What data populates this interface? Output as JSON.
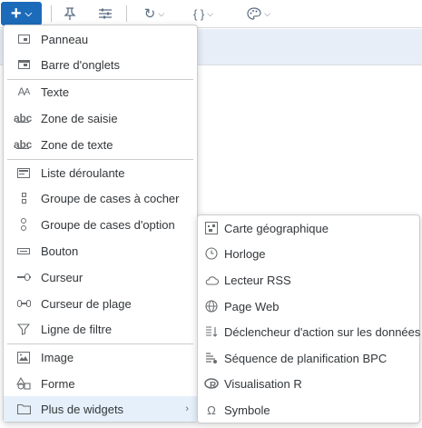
{
  "toolbar": {
    "add_icon": "plus-icon",
    "buttons": [
      {
        "name": "add-widget-button",
        "icon": "plus"
      },
      {
        "name": "pin-button",
        "icon": "pin"
      },
      {
        "name": "filter-button",
        "icon": "sliders"
      },
      {
        "name": "refresh-button",
        "icon": "refresh"
      },
      {
        "name": "script-button",
        "icon": "braces"
      },
      {
        "name": "theme-button",
        "icon": "palette"
      }
    ]
  },
  "menu": {
    "items": [
      {
        "label": "Panneau",
        "icon": "panel-icon"
      },
      {
        "label": "Barre d'onglets",
        "icon": "tabstrip-icon"
      },
      {
        "label": "Texte",
        "icon": "text-icon"
      },
      {
        "label": "Zone de saisie",
        "icon": "input-field-icon"
      },
      {
        "label": "Zone de texte",
        "icon": "text-area-icon"
      },
      {
        "label": "Liste déroulante",
        "icon": "dropdown-icon"
      },
      {
        "label": "Groupe de cases à cocher",
        "icon": "checkbox-group-icon"
      },
      {
        "label": "Groupe de cases d'option",
        "icon": "radio-group-icon"
      },
      {
        "label": "Bouton",
        "icon": "button-icon"
      },
      {
        "label": "Curseur",
        "icon": "slider-icon"
      },
      {
        "label": "Curseur de plage",
        "icon": "range-slider-icon"
      },
      {
        "label": "Ligne de filtre",
        "icon": "filter-icon"
      },
      {
        "label": "Image",
        "icon": "image-icon"
      },
      {
        "label": "Forme",
        "icon": "shape-icon"
      },
      {
        "label": "Plus de widgets",
        "icon": "folder-icon"
      }
    ]
  },
  "submenu": {
    "items": [
      {
        "label": "Carte géographique",
        "icon": "geo-map-icon"
      },
      {
        "label": "Horloge",
        "icon": "clock-icon"
      },
      {
        "label": "Lecteur RSS",
        "icon": "cloud-icon"
      },
      {
        "label": "Page Web",
        "icon": "globe-icon"
      },
      {
        "label": "Déclencheur d'action sur les données",
        "icon": "data-action-icon"
      },
      {
        "label": "Séquence de planification BPC",
        "icon": "bpc-sequence-icon"
      },
      {
        "label": "Visualisation R",
        "icon": "r-visualization-icon"
      },
      {
        "label": "Symbole",
        "icon": "symbol-icon"
      }
    ]
  },
  "colors": {
    "accent": "#1c6bbb",
    "active_item_bg": "#e5f0fa",
    "canvas_header": "#e8eef7"
  }
}
